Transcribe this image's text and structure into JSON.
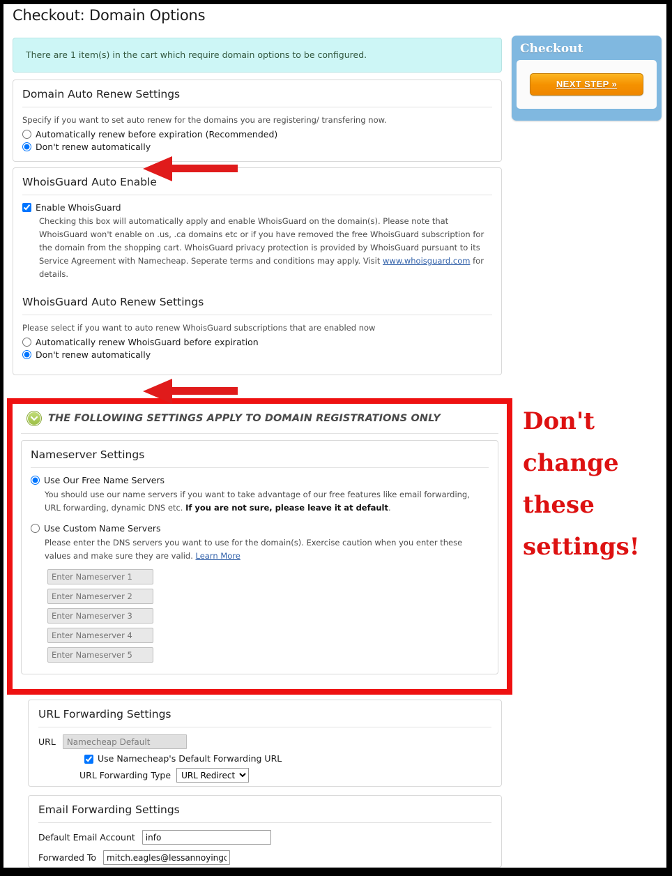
{
  "page": {
    "title": "Checkout: Domain Options",
    "info_banner": "There are 1 item(s) in the cart which require domain options to be configured."
  },
  "colors": {
    "accent_blue": "#80b8e0",
    "button_orange": "#f59100",
    "banner_cyan": "#cdf6f6",
    "highlight_red": "#ee1111",
    "annotation_red": "#dd1111",
    "icon_green": "#9cbe42",
    "link_blue": "#2f5fa8"
  },
  "domain_auto_renew": {
    "heading": "Domain Auto Renew Settings",
    "description": "Specify if you want to set auto renew for the domains you are registering/ transfering now.",
    "options": [
      {
        "label": "Automatically renew before expiration (Recommended)",
        "selected": false
      },
      {
        "label": "Don't renew automatically",
        "selected": true
      }
    ]
  },
  "whoisguard_auto_enable": {
    "heading": "WhoisGuard Auto Enable",
    "checkbox_label": "Enable WhoisGuard",
    "checked": true,
    "help_part1": "Checking this box will automatically apply and enable WhoisGuard on the domain(s). Please note that WhoisGuard won't enable on .us, .ca domains etc or if you have removed the free WhoisGuard subscription for the domain from the shopping cart. WhoisGuard privacy protection is provided by WhoisGuard pursuant to its Service Agreement with Namecheap. Seperate terms and conditions may apply. Visit ",
    "help_link": "www.whoisguard.com",
    "help_part2": " for details."
  },
  "whoisguard_auto_renew": {
    "heading": "WhoisGuard Auto Renew Settings",
    "description": "Please select if you want to auto renew WhoisGuard subscriptions that are enabled now",
    "options": [
      {
        "label": "Automatically renew WhoisGuard before expiration",
        "selected": false
      },
      {
        "label": "Don't renew automatically",
        "selected": true
      }
    ]
  },
  "registrations_only": {
    "banner_text": "THE FOLLOWING SETTINGS APPLY TO DOMAIN REGISTRATIONS ONLY",
    "icon": "chevron-down-circle-icon"
  },
  "nameserver_settings": {
    "heading": "Nameserver Settings",
    "free_option": {
      "label": "Use Our Free Name Servers",
      "selected": true,
      "help_part1": "You should use our name servers if you want to take advantage of our free features like email forwarding, URL forwarding, dynamic DNS etc. ",
      "help_bold": "If you are not sure, please leave it at default",
      "help_part2": "."
    },
    "custom_option": {
      "label": "Use Custom Name Servers",
      "selected": false,
      "help_part1": "Please enter the DNS servers you want to use for the domain(s). Exercise caution when you enter these values and make sure they are valid. ",
      "help_link": "Learn More"
    },
    "nameserver_fields": [
      {
        "placeholder": "Enter Nameserver 1",
        "value": "",
        "disabled": true
      },
      {
        "placeholder": "Enter Nameserver 2",
        "value": "",
        "disabled": true
      },
      {
        "placeholder": "Enter Nameserver 3",
        "value": "",
        "disabled": true
      },
      {
        "placeholder": "Enter Nameserver 4",
        "value": "",
        "disabled": true
      },
      {
        "placeholder": "Enter Nameserver 5",
        "value": "",
        "disabled": true
      }
    ]
  },
  "url_forwarding": {
    "heading": "URL Forwarding Settings",
    "url_label": "URL",
    "url_value": "Namecheap Default",
    "url_disabled": true,
    "default_checkbox_label": "Use Namecheap's Default Forwarding URL",
    "default_checked": true,
    "type_label": "URL Forwarding Type",
    "type_selected": "URL Redirect",
    "type_options": [
      "URL Redirect"
    ]
  },
  "email_forwarding": {
    "heading": "Email Forwarding Settings",
    "default_account_label": "Default Email Account",
    "default_account_value": "info",
    "forwarded_to_label": "Forwarded To",
    "forwarded_to_value": "mitch.eagles@lessannoyingcrr"
  },
  "checkout_sidebar": {
    "title": "Checkout",
    "next_step_label": "NEXT STEP »"
  },
  "annotation": {
    "text": "Don't change these settings!",
    "arrow_count": 2
  }
}
